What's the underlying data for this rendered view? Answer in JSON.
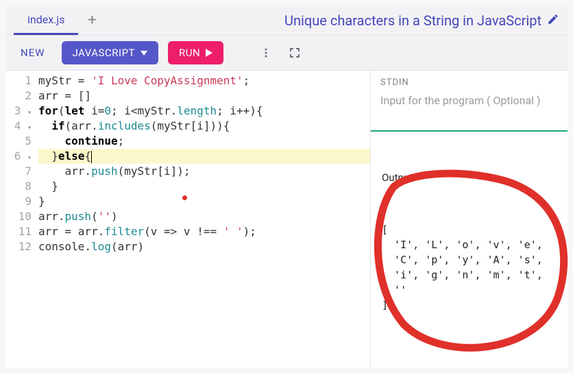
{
  "header": {
    "active_tab": "index.js",
    "title": "Unique characters in a String in JavaScript"
  },
  "toolbar": {
    "new_label": "NEW",
    "lang_label": "JAVASCRIPT",
    "run_label": "RUN"
  },
  "editor": {
    "gutter": [
      "1",
      "2",
      "3 ",
      "4 ",
      "5",
      "6 ",
      "7",
      "8",
      "9",
      "10",
      "11",
      "12"
    ],
    "gutter_marks": {
      "3": "▾",
      "4": "▾",
      "6": "▾"
    },
    "highlight_line": 6,
    "lines": [
      [
        [
          "plain",
          "myStr = "
        ],
        [
          "str",
          "'I Love CopyAssignment'"
        ],
        [
          "plain",
          ";"
        ]
      ],
      [
        [
          "plain",
          "arr = []"
        ]
      ],
      [
        [
          "kw",
          "for"
        ],
        [
          "plain",
          "("
        ],
        [
          "kw",
          "let"
        ],
        [
          "plain",
          " i="
        ],
        [
          "num",
          "0"
        ],
        [
          "plain",
          "; i<myStr."
        ],
        [
          "ident",
          "length"
        ],
        [
          "plain",
          "; i++){"
        ]
      ],
      [
        [
          "plain",
          "  "
        ],
        [
          "kw",
          "if"
        ],
        [
          "plain",
          "(arr."
        ],
        [
          "fn",
          "includes"
        ],
        [
          "plain",
          "(myStr[i])){"
        ]
      ],
      [
        [
          "plain",
          "    "
        ],
        [
          "kw",
          "continue"
        ],
        [
          "plain",
          ";"
        ]
      ],
      [
        [
          "plain",
          "  }"
        ],
        [
          "kw",
          "else"
        ],
        [
          "plain",
          "{"
        ],
        [
          "cursor",
          ""
        ]
      ],
      [
        [
          "plain",
          "    arr."
        ],
        [
          "fn",
          "push"
        ],
        [
          "plain",
          "(myStr[i]);"
        ]
      ],
      [
        [
          "plain",
          "  }"
        ]
      ],
      [
        [
          "plain",
          "}"
        ]
      ],
      [
        [
          "plain",
          "arr."
        ],
        [
          "fn",
          "push"
        ],
        [
          "plain",
          "("
        ],
        [
          "str",
          "''"
        ],
        [
          "plain",
          ")"
        ]
      ],
      [
        [
          "plain",
          "arr = arr."
        ],
        [
          "fn",
          "filter"
        ],
        [
          "plain",
          "(v => v !== "
        ],
        [
          "str",
          "' '"
        ],
        [
          "plain",
          ");"
        ]
      ],
      [
        [
          "plain",
          "console."
        ],
        [
          "fn",
          "log"
        ],
        [
          "plain",
          "(arr)"
        ]
      ]
    ]
  },
  "stdin": {
    "label": "STDIN",
    "placeholder": "Input for the program ( Optional )"
  },
  "output": {
    "label": "Output:",
    "text": "[\n  'I', 'L', 'o', 'v', 'e',\n  'C', 'p', 'y', 'A', 's',\n  'i', 'g', 'n', 'm', 't',\n  ''\n]"
  },
  "colors": {
    "accent": "#4347b8",
    "run": "#ee1e6a",
    "highlight": "#fdf7cc"
  }
}
